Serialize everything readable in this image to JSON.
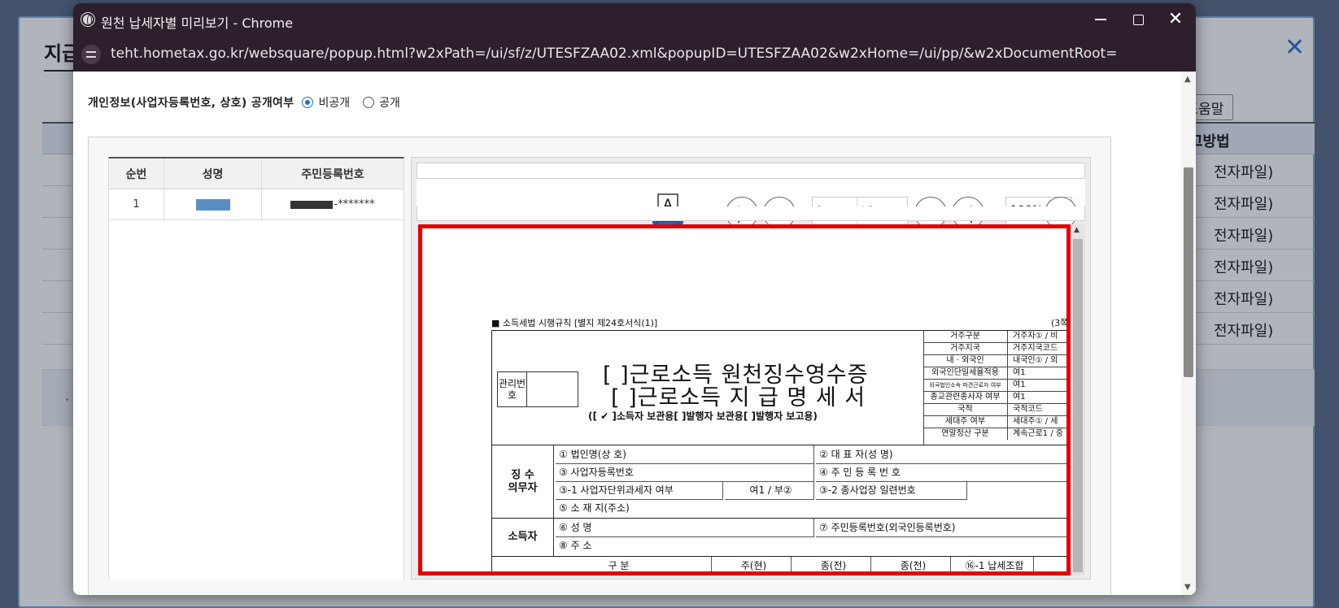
{
  "background_page": {
    "title": "지급",
    "buttons": [
      "닫기",
      "도움말"
    ],
    "buttons_visible": [
      "기",
      "도움말"
    ],
    "column_header": "고방법",
    "rows": [
      "전자파일)",
      "전자파일)",
      "전자파일)",
      "전자파일)",
      "전자파일)",
      "전자파일)"
    ],
    "panel_bullet": "·"
  },
  "window": {
    "title": "원천 납세자별 미리보기 - Chrome",
    "url": "teht.hometax.go.kr/websquare/popup.html?w2xPath=/ui/sf/z/UTESFZAA02.xml&popupID=UTESFZAA02&w2xHome=/ui/pp/&w2xDocumentRoot="
  },
  "privacy": {
    "label": "개인정보(사업자등록번호, 상호) 공개여부",
    "options": [
      {
        "label": "비공개",
        "selected": true
      },
      {
        "label": "공개",
        "selected": false
      }
    ]
  },
  "taxpayer_table": {
    "headers": [
      "순번",
      "성명",
      "주민등록번호"
    ],
    "rows": [
      {
        "no": "1",
        "name": "",
        "rrn_suffix": "-*******"
      }
    ]
  },
  "viewer": {
    "page_current": "1",
    "page_total": "/ 3",
    "zoom": "100%",
    "printer_letter": "A"
  },
  "document": {
    "form_ref": "■ 소득세법 시행규칙 [별지 제24호서식(1)]",
    "page_count": "(3쪽",
    "title_line1": "[  ]근로소득 원천징수영수증",
    "title_line2": "[  ]근로소득 지 급 명 세 서",
    "title_line3": "([ ✔ ]소득자 보관용[     ]발행자 보관용[     ]발행자 보고용)",
    "management_label": "관리번호",
    "side_grid": [
      {
        "l": "거주구분",
        "r": "거주자① / 비"
      },
      {
        "l": "거주지국",
        "r": "거주지국코드"
      },
      {
        "l": "내 · 외국인",
        "r": "내국인① / 외"
      },
      {
        "l": "외국인단일세율적용",
        "r": "여1"
      },
      {
        "l": "외국법인소속 파견근로자 여부",
        "r": "여1"
      },
      {
        "l": "종교관련종사자 여부",
        "r": "여1"
      },
      {
        "l": "국적",
        "r": "국적코드"
      },
      {
        "l": "세대주 여부",
        "r": "세대주① / 세"
      },
      {
        "l": "연말정산 구분",
        "r": "계속근로1 / 중"
      }
    ],
    "withholder_label": "징 수\n의무자",
    "withholder_cells": {
      "c1": "① 법인명(상  호)",
      "c2": "② 대 표 자(성   명)",
      "c3": "③ 사업자등록번호",
      "c4": "④ 주 민 등 록 번 호",
      "c5": "③-1 사업자단위과세자 여부",
      "c6": "여1 / 부②",
      "c7": "③-2 종사업장 일련번호",
      "c8": "⑤ 소 재 지(주소)"
    },
    "earner_label": "소득자",
    "earner_cells": {
      "c1": "⑥ 성        명",
      "c2": "⑦ 주민등록번호(외국인등록번호)",
      "c3": "-****",
      "c4": "⑧ 주        소"
    },
    "bottom_row": [
      "구  분",
      "주(현)",
      "종(전)",
      "종(전)",
      "⑯-1 납세조합",
      "합"
    ]
  }
}
